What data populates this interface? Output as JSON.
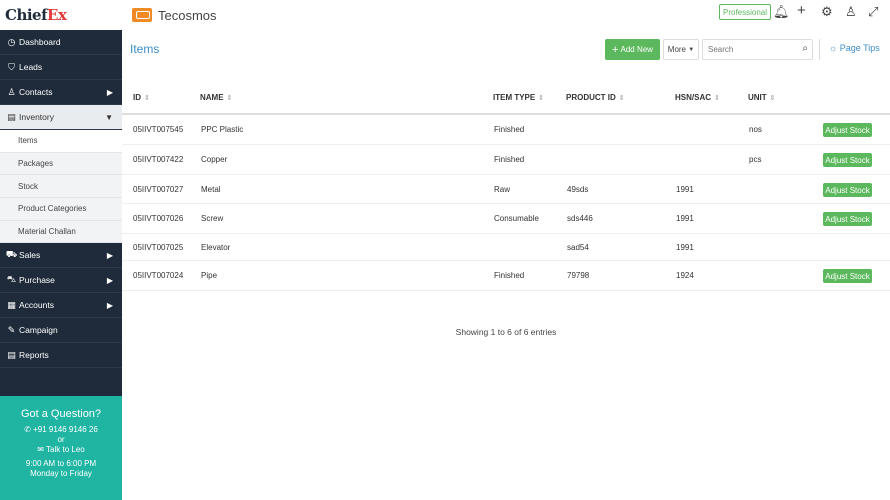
{
  "brand": {
    "logo_main": "Chief",
    "logo_accent": "Ex"
  },
  "org": {
    "name": "Tecosmos",
    "logo_text": "TECOSMOS"
  },
  "plan": {
    "label": "Professional"
  },
  "sidebar": {
    "items": [
      {
        "label": "Dashboard",
        "icon": "dashboard-icon",
        "glyph": "◷",
        "caret": ""
      },
      {
        "label": "Leads",
        "icon": "filter-icon",
        "glyph": "⛉",
        "caret": ""
      },
      {
        "label": "Contacts",
        "icon": "person-icon",
        "glyph": "♙",
        "caret": "▶"
      },
      {
        "label": "Inventory",
        "icon": "inventory-icon",
        "glyph": "▤",
        "caret": "▼"
      },
      {
        "label": "Sales",
        "icon": "sales-icon",
        "glyph": "⛟",
        "caret": "▶"
      },
      {
        "label": "Purchase",
        "icon": "cart-icon",
        "glyph": "⛍",
        "caret": "▶"
      },
      {
        "label": "Accounts",
        "icon": "calculator-icon",
        "glyph": "▦",
        "caret": "▶"
      },
      {
        "label": "Campaign",
        "icon": "megaphone-icon",
        "glyph": "✎",
        "caret": ""
      },
      {
        "label": "Reports",
        "icon": "report-icon",
        "glyph": "▤",
        "caret": ""
      }
    ],
    "inventory_sub": [
      "Items",
      "Packages",
      "Stock",
      "Product Categories",
      "Material Challan"
    ]
  },
  "help": {
    "title": "Got a Question?",
    "phone": "+91 9146 9146 26",
    "or": "or",
    "talk": "Talk to Leo",
    "hours": "9:00 AM to 6:00 PM",
    "days": "Monday to Friday"
  },
  "page": {
    "title": "Items",
    "add_label": "Add New",
    "more_label": "More",
    "search_placeholder": "Search",
    "tips_label": "Page Tips"
  },
  "table": {
    "headers": [
      "ID",
      "NAME",
      "ITEM TYPE",
      "PRODUCT ID",
      "HSN/SAC",
      "UNIT"
    ],
    "action_label": "Adjust Stock",
    "rows": [
      {
        "id": "05IIVT007545",
        "name": "PPC Plastic",
        "type": "Finished",
        "product_id": "",
        "hsn": "",
        "unit": "nos",
        "adjust": true
      },
      {
        "id": "05IIVT007422",
        "name": "Copper",
        "type": "Finished",
        "product_id": "",
        "hsn": "",
        "unit": "pcs",
        "adjust": true
      },
      {
        "id": "05IIVT007027",
        "name": "Metal",
        "type": "Raw",
        "product_id": "49sds",
        "hsn": "1991",
        "unit": "",
        "adjust": true
      },
      {
        "id": "05IIVT007026",
        "name": "Screw",
        "type": "Consumable",
        "product_id": "sds446",
        "hsn": "1991",
        "unit": "",
        "adjust": true
      },
      {
        "id": "05IIVT007025",
        "name": "Elevator",
        "type": "",
        "product_id": "sad54",
        "hsn": "1991",
        "unit": "",
        "adjust": false
      },
      {
        "id": "05IIVT007024",
        "name": "Pipe",
        "type": "Finished",
        "product_id": "79798",
        "hsn": "1924",
        "unit": "",
        "adjust": true
      }
    ],
    "entries_info": "Showing 1 to 6 of 6 entries"
  },
  "colors": {
    "sidebar": "#1f2b3a",
    "accent_green": "#5cb85c",
    "accent_blue": "#3d8dc4",
    "help_teal": "#1fb5a2"
  }
}
